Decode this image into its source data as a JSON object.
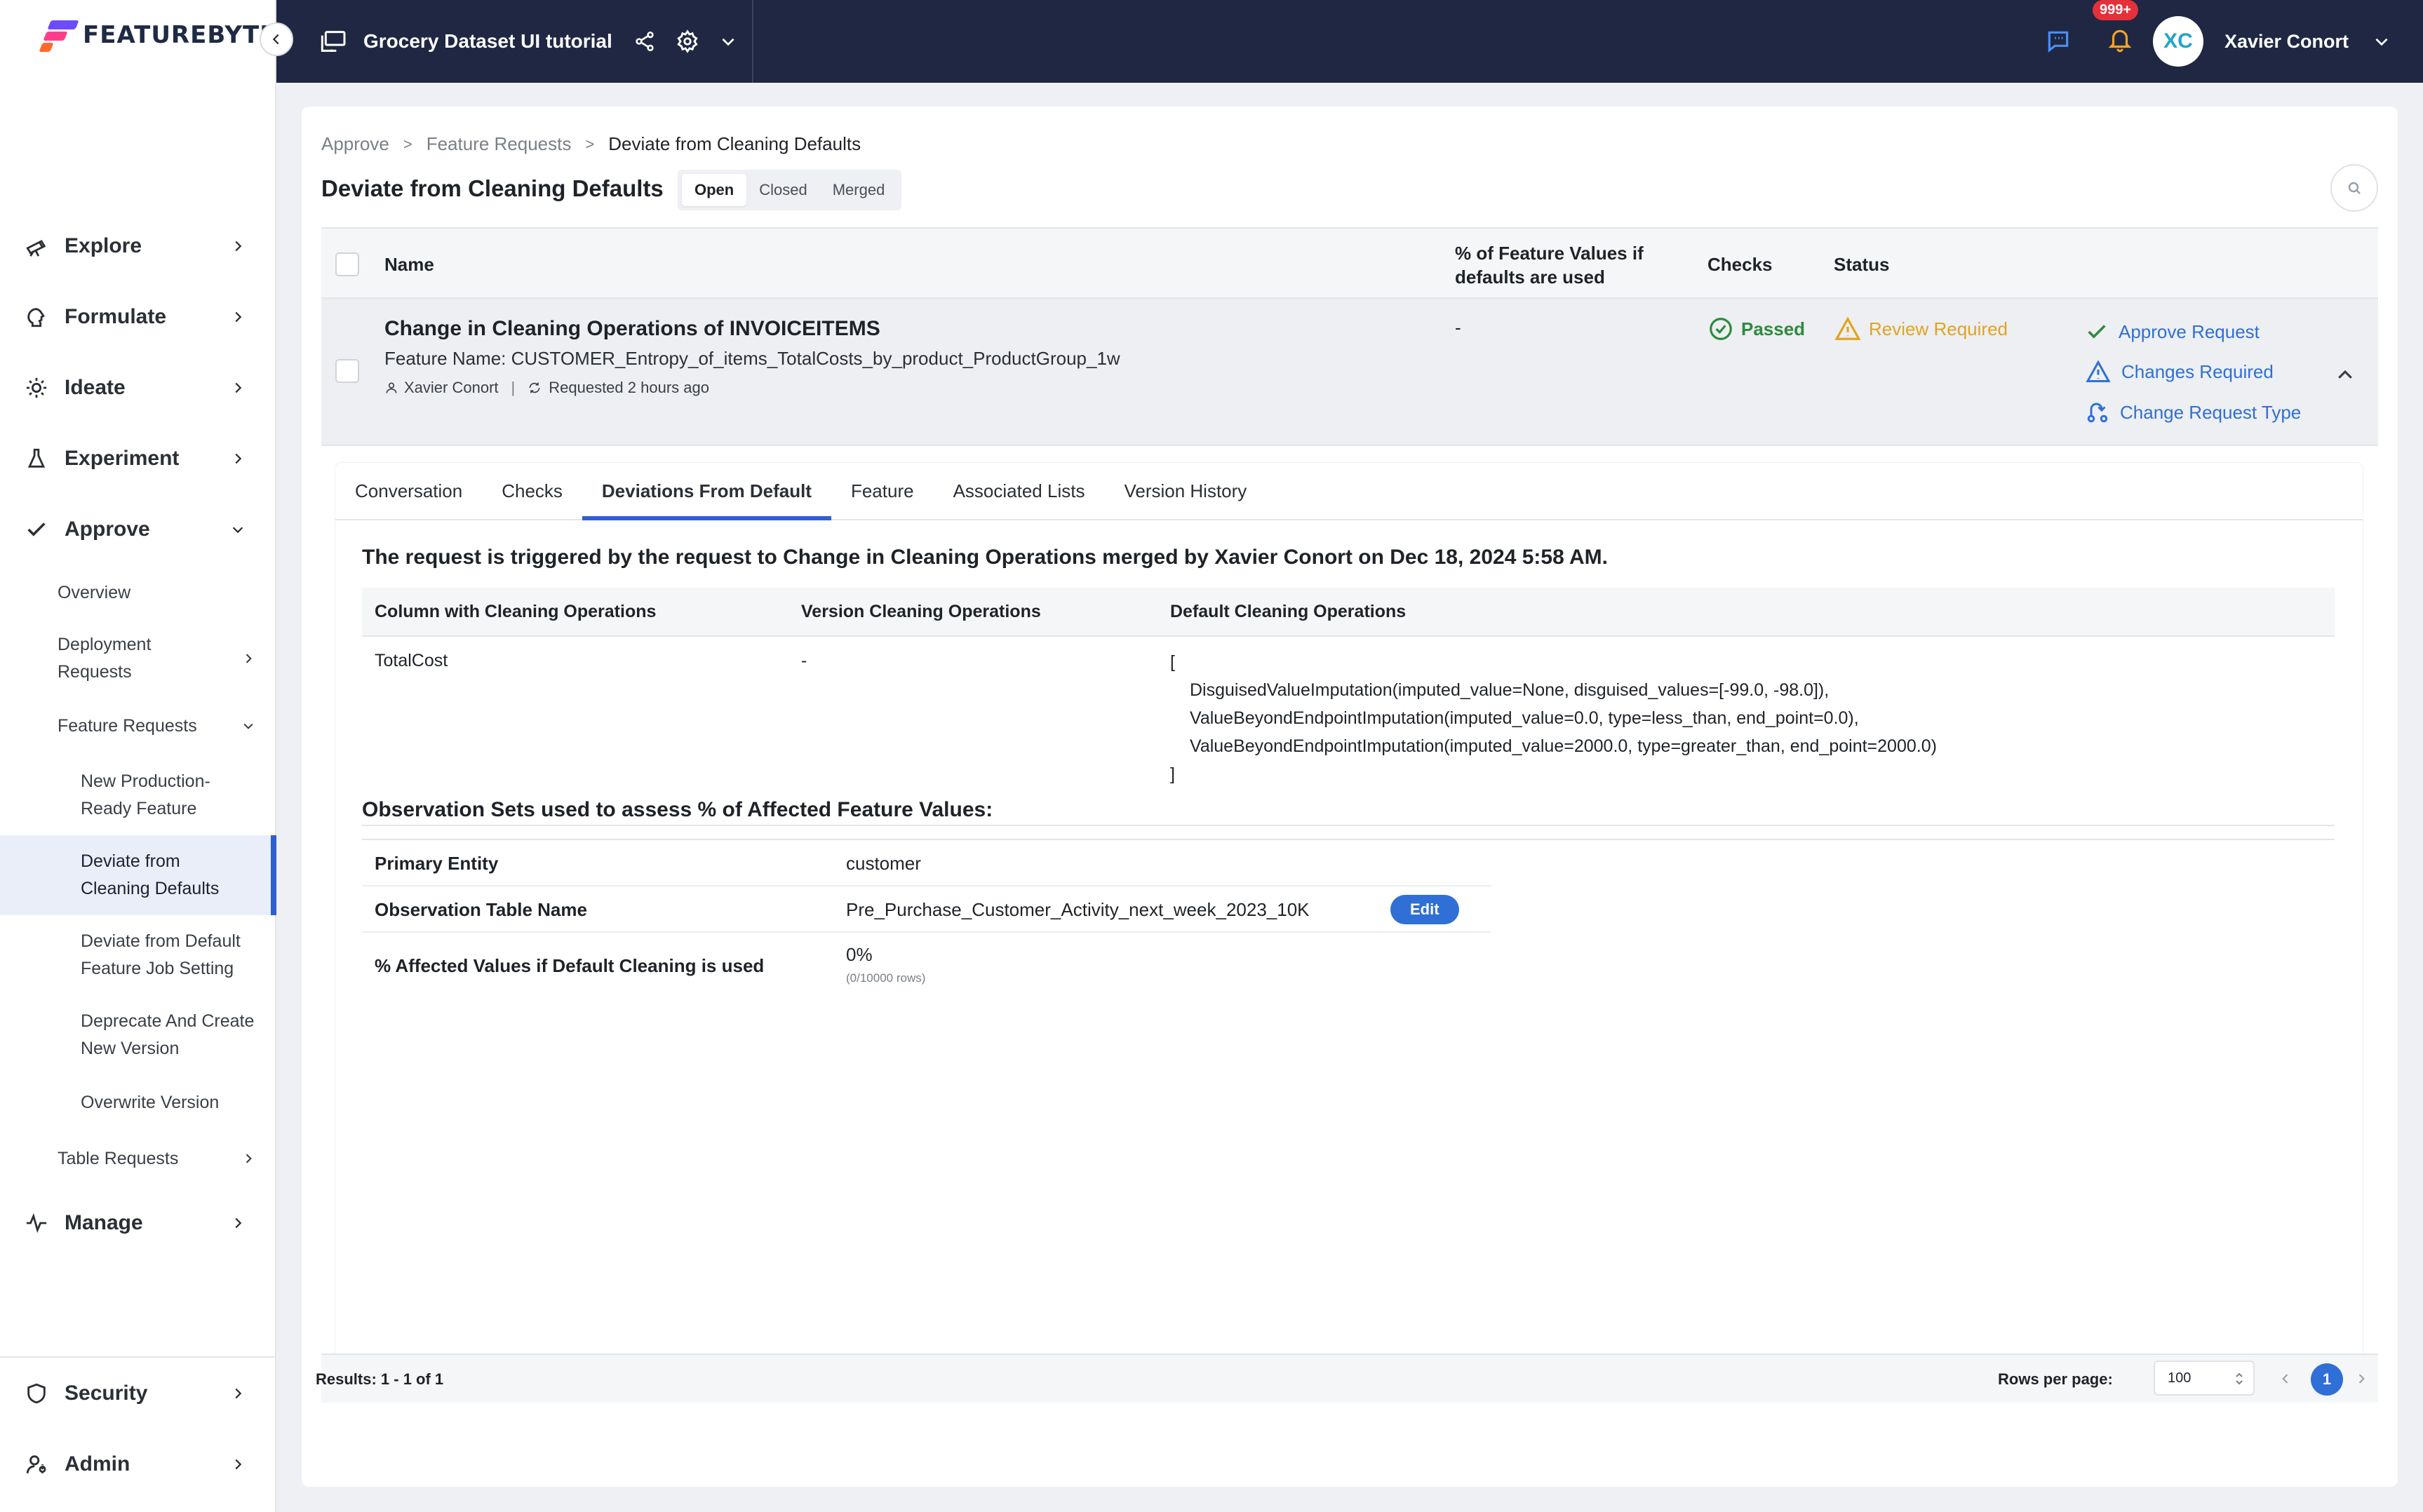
{
  "brand": {
    "name": "FEATUREBYTE"
  },
  "topbar": {
    "project": "Grocery Dataset UI tutorial",
    "notifications": "999+",
    "avatar_initials": "XC",
    "user": "Xavier Conort"
  },
  "sidebar": {
    "explore": "Explore",
    "formulate": "Formulate",
    "ideate": "Ideate",
    "experiment": "Experiment",
    "approve": "Approve",
    "approve_items": {
      "overview": "Overview",
      "deployment_requests": "Deployment Requests",
      "feature_requests": "Feature Requests",
      "table_requests": "Table Requests"
    },
    "feature_request_items": {
      "new_production": "New Production-Ready Feature",
      "deviate_cleaning": "Deviate from Cleaning Defaults",
      "deviate_job": "Deviate from Default Feature Job Setting",
      "deprecate": "Deprecate And Create New Version",
      "overwrite": "Overwrite Version"
    },
    "manage": "Manage",
    "security": "Security",
    "admin": "Admin"
  },
  "breadcrumb": {
    "b1": "Approve",
    "b2": "Feature Requests",
    "b3": "Deviate from Cleaning Defaults",
    "sep": ">"
  },
  "page": {
    "title": "Deviate from Cleaning Defaults",
    "filters": {
      "open": "Open",
      "closed": "Closed",
      "merged": "Merged"
    }
  },
  "table": {
    "headers": {
      "name": "Name",
      "pct": "% of Feature Values if defaults are used",
      "checks": "Checks",
      "status": "Status"
    },
    "row": {
      "title": "Change in Cleaning Operations of INVOICEITEMS",
      "feature_name": "Feature Name: CUSTOMER_Entropy_of_items_TotalCosts_by_product_ProductGroup_1w",
      "author": "Xavier Conort",
      "requested": "Requested 2 hours ago",
      "pct": "-",
      "checks": "Passed",
      "status": "Review Required",
      "actions": {
        "approve": "Approve Request",
        "changes": "Changes Required",
        "change_type": "Change Request Type"
      }
    }
  },
  "tabs": {
    "conversation": "Conversation",
    "checks": "Checks",
    "deviations": "Deviations From Default",
    "feature": "Feature",
    "lists": "Associated Lists",
    "history": "Version History"
  },
  "deviation": {
    "trigger_text": "The request is triggered by the request to Change in Cleaning Operations merged by Xavier Conort on Dec 18, 2024 5:58 AM.",
    "headers": {
      "col": "Column with Cleaning Operations",
      "version": "Version Cleaning Operations",
      "default": "Default Cleaning Operations"
    },
    "row": {
      "column": "TotalCost",
      "version": "-",
      "open": "[",
      "op1": "DisguisedValueImputation(imputed_value=None, disguised_values=[-99.0, -98.0]),",
      "op2": "ValueBeyondEndpointImputation(imputed_value=0.0, type=less_than, end_point=0.0),",
      "op3": "ValueBeyondEndpointImputation(imputed_value=2000.0, type=greater_than, end_point=2000.0)",
      "close": "]"
    }
  },
  "observation": {
    "title": "Observation Sets used to assess % of Affected Feature Values:",
    "primary_entity_label": "Primary Entity",
    "primary_entity": "customer",
    "table_name_label": "Observation Table Name",
    "table_name": "Pre_Purchase_Customer_Activity_next_week_2023_10K",
    "edit": "Edit",
    "affected_label": "% Affected Values if Default Cleaning is used",
    "affected": "0%",
    "affected_rows": "(0/10000 rows)"
  },
  "footer": {
    "results": "Results: 1 - 1 of 1",
    "rows_per_page_label": "Rows per page:",
    "rows_per_page": "100",
    "page": "1"
  },
  "colors": {
    "accent": "#2f6fd6",
    "topbar": "#1f2742",
    "passed": "#2d8a3e",
    "review": "#e0a41f"
  }
}
